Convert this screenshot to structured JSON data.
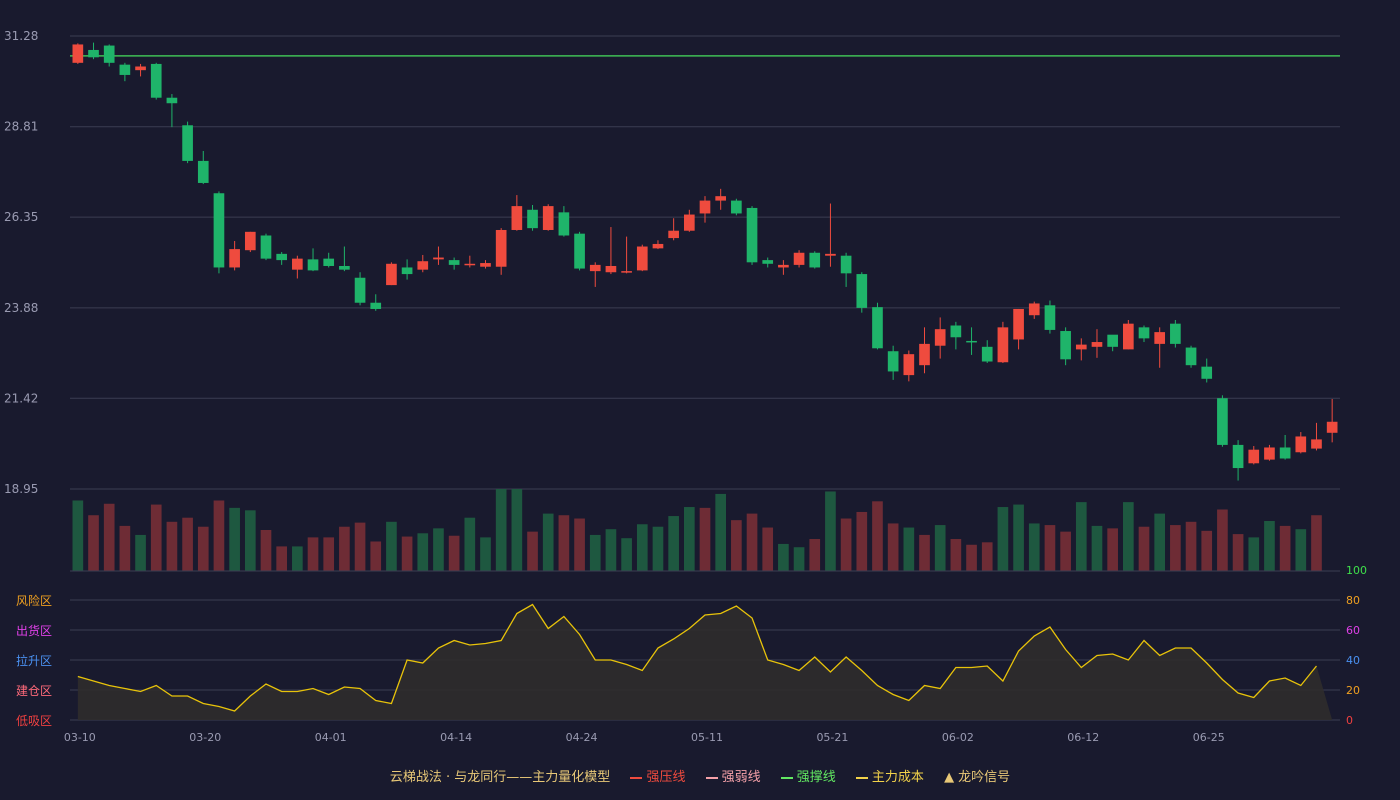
{
  "chart_data": {
    "type": "candlestick",
    "price_axis": {
      "ticks": [
        "31.28",
        "28.81",
        "26.35",
        "23.88",
        "21.42",
        "18.95"
      ],
      "range": [
        18.95,
        31.28
      ]
    },
    "x_ticks": [
      {
        "index": 0,
        "label": "03-10"
      },
      {
        "index": 8,
        "label": "03-20"
      },
      {
        "index": 16,
        "label": "04-01"
      },
      {
        "index": 24,
        "label": "04-14"
      },
      {
        "index": 32,
        "label": "04-24"
      },
      {
        "index": 40,
        "label": "05-11"
      },
      {
        "index": 48,
        "label": "05-21"
      },
      {
        "index": 56,
        "label": "06-02"
      },
      {
        "index": 64,
        "label": "06-12"
      },
      {
        "index": 72,
        "label": "06-25"
      }
    ],
    "resistance_line": 30.74,
    "candles": [
      [
        30.55,
        31.05,
        31.08,
        30.52
      ],
      [
        30.9,
        30.7,
        31.1,
        30.65
      ],
      [
        31.02,
        30.55,
        31.05,
        30.45
      ],
      [
        30.5,
        30.22,
        30.55,
        30.05
      ],
      [
        30.35,
        30.45,
        30.52,
        30.18
      ],
      [
        30.52,
        29.6,
        30.55,
        29.55
      ],
      [
        29.6,
        29.45,
        29.7,
        28.8
      ],
      [
        28.85,
        27.88,
        28.95,
        27.82
      ],
      [
        27.88,
        27.28,
        28.15,
        27.25
      ],
      [
        27.0,
        24.98,
        27.05,
        24.82
      ],
      [
        24.98,
        25.48,
        25.7,
        24.9
      ],
      [
        25.45,
        25.95,
        25.95,
        25.4
      ],
      [
        25.85,
        25.22,
        25.9,
        25.18
      ],
      [
        25.35,
        25.18,
        25.4,
        25.05
      ],
      [
        24.92,
        25.22,
        25.3,
        24.68
      ],
      [
        25.2,
        24.9,
        25.5,
        24.88
      ],
      [
        25.22,
        25.02,
        25.38,
        24.98
      ],
      [
        25.02,
        24.92,
        25.55,
        24.88
      ],
      [
        24.7,
        24.02,
        24.85,
        23.95
      ],
      [
        24.02,
        23.85,
        24.25,
        23.8
      ],
      [
        24.5,
        25.08,
        25.12,
        24.5
      ],
      [
        24.98,
        24.8,
        25.2,
        24.65
      ],
      [
        24.92,
        25.15,
        25.32,
        24.85
      ],
      [
        25.2,
        25.25,
        25.55,
        25.05
      ],
      [
        25.18,
        25.05,
        25.25,
        24.92
      ],
      [
        25.08,
        25.08,
        25.3,
        24.98
      ],
      [
        25.0,
        25.1,
        25.18,
        24.95
      ],
      [
        25.0,
        26.0,
        26.05,
        24.78
      ],
      [
        26.0,
        26.65,
        26.95,
        25.98
      ],
      [
        26.55,
        26.05,
        26.68,
        25.98
      ],
      [
        26.0,
        26.65,
        26.7,
        25.98
      ],
      [
        26.48,
        25.85,
        26.65,
        25.82
      ],
      [
        25.9,
        24.95,
        25.95,
        24.9
      ],
      [
        24.88,
        25.05,
        25.12,
        24.45
      ],
      [
        24.85,
        25.02,
        26.08,
        24.8
      ],
      [
        24.85,
        24.88,
        25.82,
        24.82
      ],
      [
        24.9,
        25.55,
        25.6,
        24.88
      ],
      [
        25.5,
        25.62,
        25.72,
        25.48
      ],
      [
        25.78,
        25.98,
        26.32,
        25.72
      ],
      [
        25.98,
        26.42,
        26.55,
        25.95
      ],
      [
        26.45,
        26.8,
        26.92,
        26.2
      ],
      [
        26.8,
        26.92,
        27.12,
        26.55
      ],
      [
        26.8,
        26.45,
        26.85,
        26.4
      ],
      [
        26.6,
        25.12,
        26.65,
        25.05
      ],
      [
        25.18,
        25.08,
        25.25,
        24.98
      ],
      [
        24.98,
        25.05,
        25.18,
        24.78
      ],
      [
        25.05,
        25.38,
        25.45,
        24.98
      ],
      [
        25.38,
        24.98,
        25.42,
        24.95
      ],
      [
        25.3,
        25.35,
        26.72,
        25.0
      ],
      [
        25.3,
        24.82,
        25.38,
        24.45
      ],
      [
        24.8,
        23.88,
        24.85,
        23.75
      ],
      [
        23.9,
        22.78,
        24.02,
        22.75
      ],
      [
        22.7,
        22.15,
        22.85,
        21.92
      ],
      [
        22.05,
        22.62,
        22.72,
        21.88
      ],
      [
        22.32,
        22.9,
        23.35,
        22.1
      ],
      [
        22.85,
        23.3,
        23.62,
        22.5
      ],
      [
        23.4,
        23.08,
        23.5,
        22.75
      ],
      [
        22.98,
        22.95,
        23.35,
        22.6
      ],
      [
        22.82,
        22.42,
        23.0,
        22.38
      ],
      [
        22.4,
        23.35,
        23.5,
        22.38
      ],
      [
        23.02,
        23.85,
        23.85,
        22.75
      ],
      [
        23.68,
        24.0,
        24.05,
        23.58
      ],
      [
        23.95,
        23.28,
        24.08,
        23.18
      ],
      [
        23.25,
        22.48,
        23.35,
        22.32
      ],
      [
        22.75,
        22.88,
        23.05,
        22.45
      ],
      [
        22.82,
        22.95,
        23.3,
        22.52
      ],
      [
        23.15,
        22.82,
        23.1,
        22.7
      ],
      [
        22.75,
        23.45,
        23.55,
        22.75
      ],
      [
        23.35,
        23.05,
        23.4,
        22.95
      ],
      [
        22.9,
        23.22,
        23.35,
        22.25
      ],
      [
        23.45,
        22.9,
        23.55,
        22.8
      ],
      [
        22.8,
        22.32,
        22.85,
        22.25
      ],
      [
        22.28,
        21.95,
        22.5,
        21.85
      ],
      [
        21.42,
        20.15,
        21.5,
        20.1
      ],
      [
        20.15,
        19.52,
        20.28,
        19.18
      ],
      [
        19.65,
        20.02,
        20.12,
        19.62
      ],
      [
        19.75,
        20.08,
        20.15,
        19.72
      ],
      [
        20.08,
        19.78,
        20.42,
        19.75
      ],
      [
        19.95,
        20.38,
        20.5,
        19.92
      ],
      [
        20.05,
        20.3,
        20.75,
        20.0
      ],
      [
        20.48,
        20.78,
        21.4,
        20.22
      ]
    ],
    "volume_max": 100,
    "volume": [
      [
        86,
        0
      ],
      [
        68,
        1
      ],
      [
        82,
        1
      ],
      [
        55,
        1
      ],
      [
        44,
        0
      ],
      [
        81,
        1
      ],
      [
        60,
        1
      ],
      [
        65,
        1
      ],
      [
        54,
        1
      ],
      [
        86,
        1
      ],
      [
        77,
        0
      ],
      [
        74,
        0
      ],
      [
        50,
        1
      ],
      [
        30,
        1
      ],
      [
        30,
        0
      ],
      [
        41,
        1
      ],
      [
        41,
        1
      ],
      [
        54,
        1
      ],
      [
        59,
        1
      ],
      [
        36,
        1
      ],
      [
        60,
        0
      ],
      [
        42,
        1
      ],
      [
        46,
        0
      ],
      [
        52,
        0
      ],
      [
        43,
        1
      ],
      [
        65,
        0
      ],
      [
        41,
        0
      ],
      [
        100,
        0
      ],
      [
        100,
        0
      ],
      [
        48,
        1
      ],
      [
        70,
        0
      ],
      [
        68,
        1
      ],
      [
        64,
        1
      ],
      [
        44,
        0
      ],
      [
        51,
        0
      ],
      [
        40,
        0
      ],
      [
        57,
        0
      ],
      [
        54,
        0
      ],
      [
        67,
        0
      ],
      [
        78,
        0
      ],
      [
        77,
        1
      ],
      [
        94,
        0
      ],
      [
        62,
        1
      ],
      [
        70,
        1
      ],
      [
        53,
        1
      ],
      [
        33,
        0
      ],
      [
        29,
        0
      ],
      [
        39,
        1
      ],
      [
        97,
        0
      ],
      [
        64,
        1
      ],
      [
        72,
        1
      ],
      [
        85,
        1
      ],
      [
        58,
        1
      ],
      [
        53,
        0
      ],
      [
        44,
        1
      ],
      [
        56,
        0
      ],
      [
        39,
        1
      ],
      [
        32,
        1
      ],
      [
        35,
        1
      ],
      [
        78,
        0
      ],
      [
        81,
        0
      ],
      [
        58,
        0
      ],
      [
        56,
        1
      ],
      [
        48,
        1
      ],
      [
        84,
        0
      ],
      [
        55,
        0
      ],
      [
        52,
        1
      ],
      [
        84,
        0
      ],
      [
        54,
        1
      ],
      [
        70,
        0
      ],
      [
        56,
        1
      ],
      [
        60,
        1
      ],
      [
        49,
        1
      ],
      [
        75,
        1
      ],
      [
        45,
        1
      ],
      [
        41,
        0
      ],
      [
        61,
        0
      ],
      [
        55,
        1
      ],
      [
        51,
        0
      ],
      [
        68,
        1
      ]
    ],
    "indicator": {
      "right_ticks": [
        "100",
        "80",
        "60",
        "40",
        "20",
        "0"
      ],
      "zones": [
        "风险区",
        "出货区",
        "拉升区",
        "建仓区",
        "低吸区"
      ],
      "range": [
        0,
        100
      ],
      "values": [
        29,
        26,
        23,
        21,
        19,
        23,
        16,
        16,
        11,
        9,
        6,
        16,
        24,
        19,
        19,
        21,
        17,
        22,
        21,
        13,
        11,
        40,
        38,
        48,
        53,
        50,
        51,
        53,
        71,
        77,
        61,
        69,
        57,
        40,
        40,
        37,
        33,
        48,
        54,
        61,
        70,
        71,
        76,
        68,
        40,
        37,
        33,
        42,
        32,
        42,
        33,
        23,
        17,
        13,
        23,
        21,
        35,
        35,
        36,
        26,
        46,
        56,
        62,
        47,
        35,
        43,
        44,
        40,
        53,
        43,
        48,
        48,
        38,
        27,
        18,
        15,
        26,
        28,
        23,
        36
      ]
    },
    "legend": [
      {
        "label": "云梯战法 · 与龙同行——主力量化模型",
        "marker": "none",
        "color": "#e8c877"
      },
      {
        "label": "强压线",
        "marker": "line",
        "color": "#ef4b3e"
      },
      {
        "label": "强弱线",
        "marker": "dash",
        "color": "#f4a0a8"
      },
      {
        "label": "强撑线",
        "marker": "line",
        "color": "#62e862"
      },
      {
        "label": "主力成本",
        "marker": "dash",
        "color": "#f2d24a"
      },
      {
        "label": "龙吟信号",
        "marker": "triangle",
        "color": "#e8c877"
      }
    ],
    "colors": {
      "background": "#191a2e",
      "up": "#ef4b3e",
      "down": "#1fb46a",
      "volume_up": "#6e2c35",
      "volume_down": "#1e5840",
      "grid": "#3b3d52",
      "axis_text": "#9a9bb2",
      "resistance": "#3fbf55",
      "indicator_line": "#e8c30a",
      "indicator_fill": "#2f2c2c",
      "tick_100": "#3ee04a",
      "tick_80": "#f0a020",
      "tick_60": "#e040e8",
      "tick_40": "#4a90f0",
      "tick_20": "#f0a020",
      "tick_0": "#f04040",
      "zone_risk": "#f0a020",
      "zone_sell": "#e040e8",
      "zone_rise": "#4a90f0",
      "zone_build": "#ff6a7a",
      "zone_low": "#f04040"
    }
  }
}
